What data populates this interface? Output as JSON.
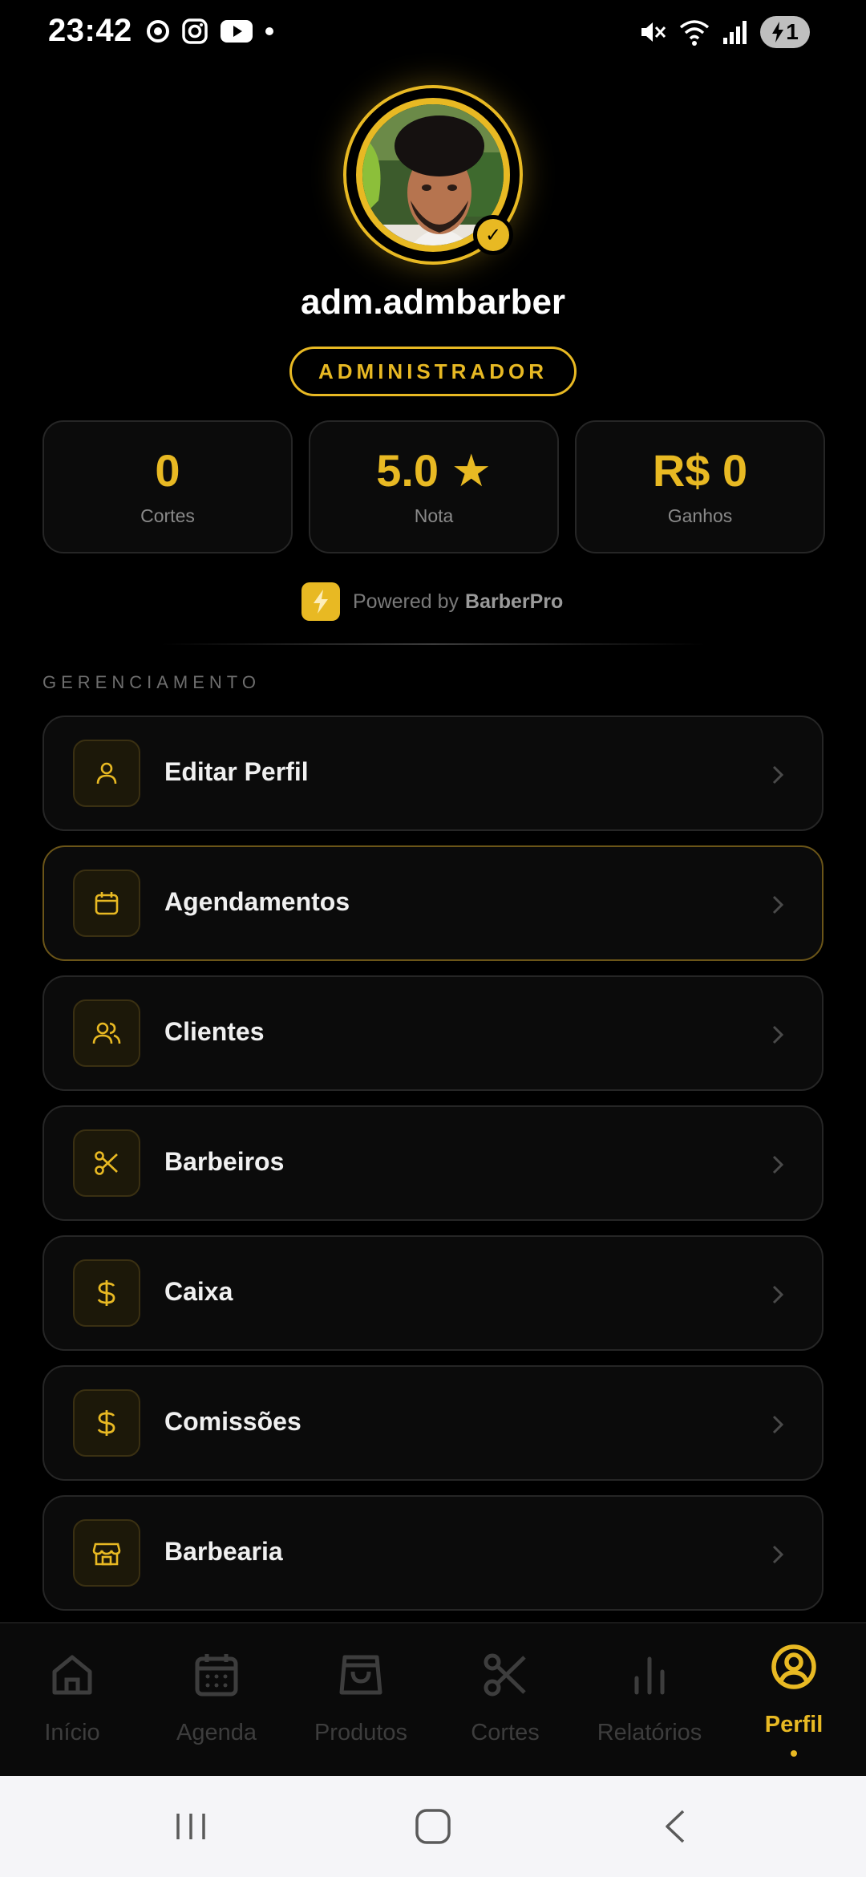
{
  "status_bar": {
    "time": "23:42",
    "left_icons": [
      "chrome-icon",
      "instagram-icon",
      "youtube-icon",
      "dot-icon"
    ],
    "right_icons": [
      "mute-icon",
      "wifi-icon",
      "signal-icon"
    ],
    "battery": "1"
  },
  "profile": {
    "username": "adm.admbarber",
    "role": "ADMINISTRADOR"
  },
  "stats": [
    {
      "value": "0",
      "label": "Cortes"
    },
    {
      "value": "5.0 ★",
      "label": "Nota"
    },
    {
      "value": "R$ 0",
      "label": "Ganhos"
    }
  ],
  "powered": {
    "prefix": "Powered by",
    "brand": "BarberPro"
  },
  "section_title": "GERENCIAMENTO",
  "menu": [
    {
      "label": "Editar Perfil",
      "icon": "user-icon"
    },
    {
      "label": "Agendamentos",
      "icon": "calendar-icon"
    },
    {
      "label": "Clientes",
      "icon": "users-icon"
    },
    {
      "label": "Barbeiros",
      "icon": "scissors-icon"
    },
    {
      "label": "Caixa",
      "icon": "dollar-icon"
    },
    {
      "label": "Comissões",
      "icon": "dollar-icon"
    },
    {
      "label": "Barbearia",
      "icon": "store-icon"
    }
  ],
  "bottom_nav": [
    {
      "label": "Início",
      "icon": "home-icon"
    },
    {
      "label": "Agenda",
      "icon": "calendar-icon"
    },
    {
      "label": "Produtos",
      "icon": "bag-icon"
    },
    {
      "label": "Cortes",
      "icon": "scissors-icon"
    },
    {
      "label": "Relatórios",
      "icon": "bar-chart-icon"
    },
    {
      "label": "Perfil",
      "icon": "profile-icon",
      "active": true
    }
  ],
  "colors": {
    "accent": "#e8b923",
    "background": "#000000",
    "card": "#0b0b0b",
    "muted": "#8a8a8a"
  }
}
